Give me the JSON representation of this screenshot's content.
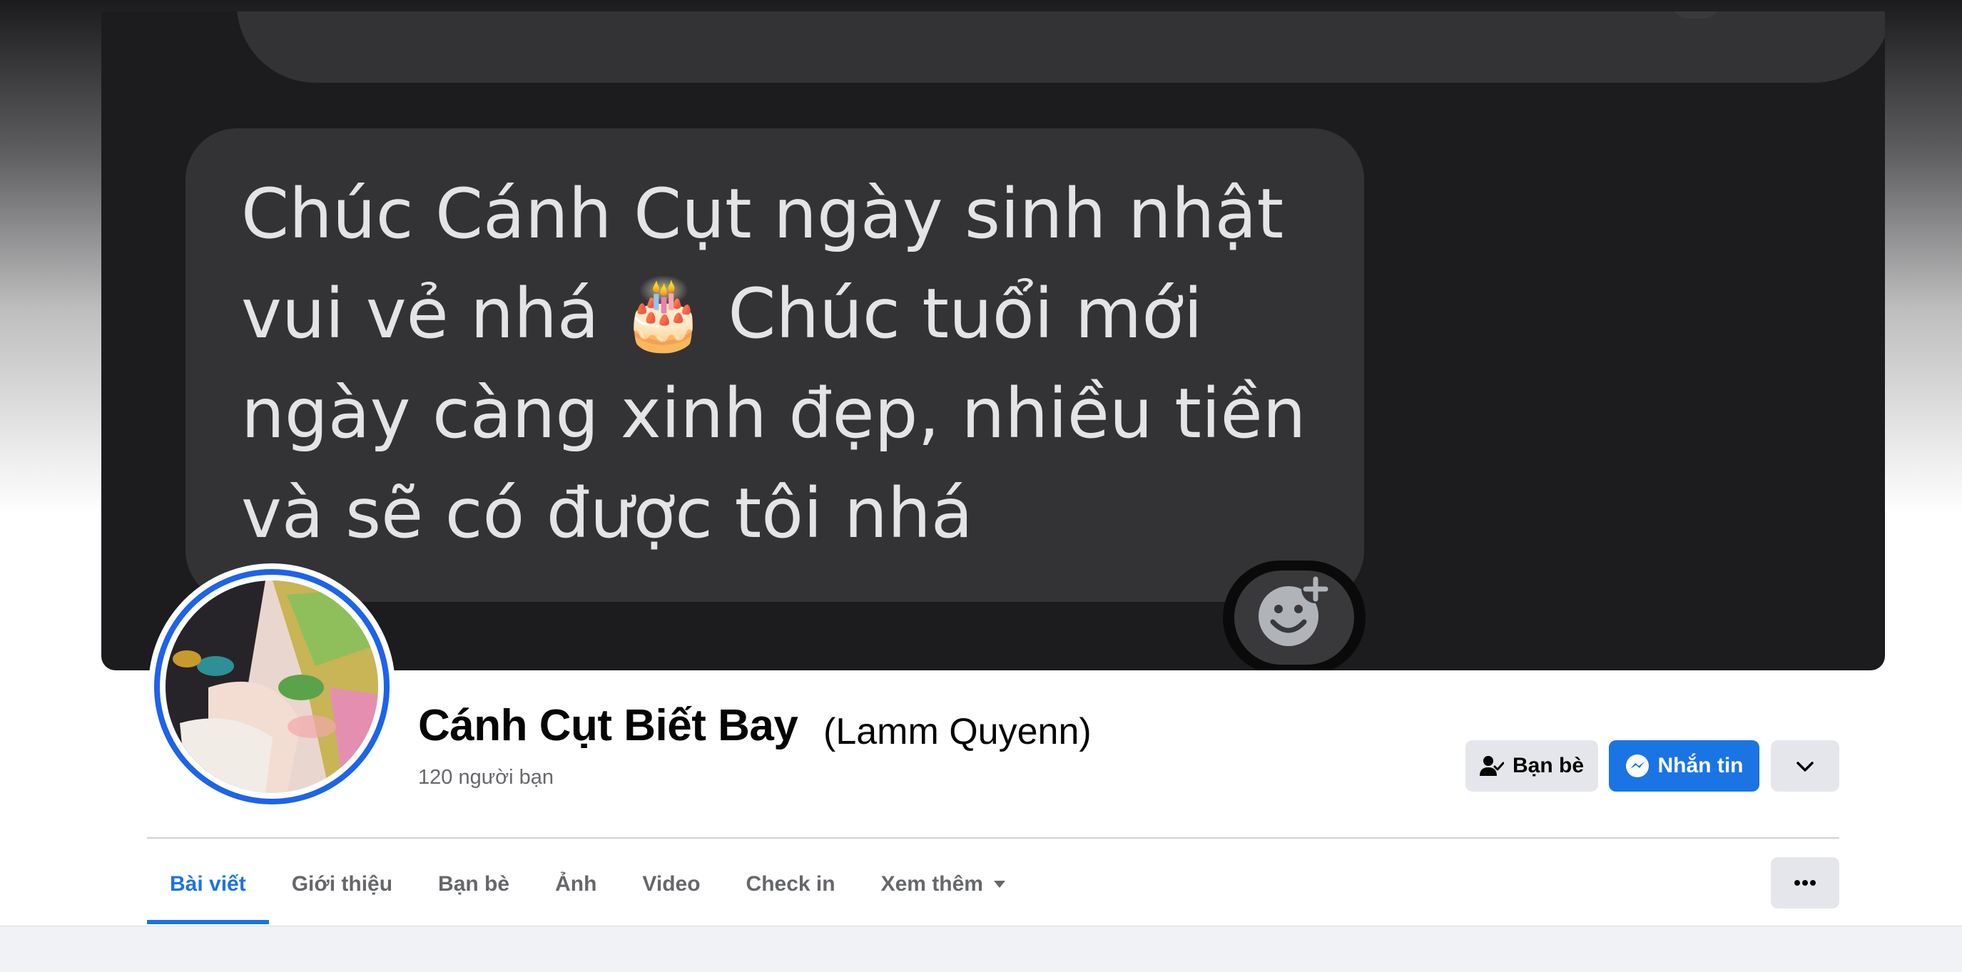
{
  "cover": {
    "message_text": "Chúc Cánh Cụt ngày sinh nhật\nvui vẻ nhá 🎂 Chúc tuổi mới\nngày càng xinh đẹp, nhiều tiền\nvà sẽ có được tôi nhá"
  },
  "profile": {
    "name": "Cánh Cụt Biết Bay",
    "alternate_name": "(Lamm Quyenn)",
    "friend_count": "120 người bạn"
  },
  "actions": {
    "friends_label": "Bạn bè",
    "message_label": "Nhắn tin"
  },
  "tabs": [
    {
      "label": "Bài viết",
      "active": true
    },
    {
      "label": "Giới thiệu",
      "active": false
    },
    {
      "label": "Bạn bè",
      "active": false
    },
    {
      "label": "Ảnh",
      "active": false
    },
    {
      "label": "Video",
      "active": false
    },
    {
      "label": "Check in",
      "active": false
    },
    {
      "label": "Xem thêm",
      "active": false
    }
  ],
  "colors": {
    "accent": "#1b74e4",
    "avatar_ring": "#1d63eb",
    "button_gray": "#e4e6eb",
    "secondary_text": "#65676b"
  },
  "icons": [
    "add-reaction-icon",
    "friends-check-icon",
    "messenger-icon",
    "chevron-down-icon",
    "caret-down-icon",
    "more-dots-icon"
  ]
}
